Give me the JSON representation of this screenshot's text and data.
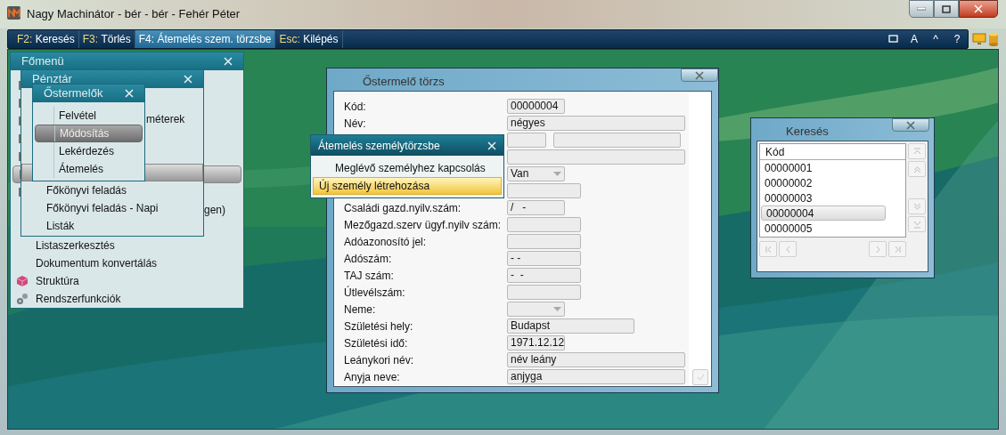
{
  "window": {
    "title": "Nagy Machinátor - bér - bér - Fehér Péter"
  },
  "toolbar": {
    "commands": [
      {
        "key": "F2:",
        "label": "Keresés",
        "selected": false
      },
      {
        "key": "F3:",
        "label": "Törlés",
        "selected": false
      },
      {
        "key": "F4:",
        "label": "Átemelés szem. törzsbe",
        "selected": true
      },
      {
        "key": "Esc:",
        "label": "Kilépés",
        "selected": false
      }
    ],
    "buttons": [
      "A",
      "^",
      "?"
    ]
  },
  "main_menu": {
    "title": "Főmenü",
    "items": [
      {
        "kind": "app",
        "selected": false
      },
      {
        "kind": "app",
        "selected": false
      },
      {
        "kind": "app",
        "selected": false
      },
      {
        "kind": "app",
        "selected": false
      },
      {
        "kind": "app",
        "selected": false
      },
      {
        "kind": "app",
        "selected": true
      },
      {
        "kind": "app",
        "selected": false
      },
      {
        "kind": "none",
        "text": "gen)",
        "selected": false
      },
      {
        "kind": "none",
        "selected": false
      },
      {
        "kind": "none",
        "text": "Listaszerkesztés",
        "selected": false
      },
      {
        "kind": "none",
        "text": "Dokumentum konvertálás",
        "selected": false
      },
      {
        "kind": "cube",
        "text": "Struktúra",
        "selected": false
      },
      {
        "kind": "gears",
        "text": "Rendszerfunkciók",
        "selected": false
      }
    ]
  },
  "cash_menu": {
    "title": "Pénztár",
    "items": [
      {
        "selected": false
      },
      {
        "text": "méterek",
        "selected": false
      },
      {
        "selected": false
      },
      {
        "selected": false
      },
      {
        "selected": true
      },
      {
        "text": "Főkönyvi feladás",
        "selected": false
      },
      {
        "text": "Főkönyvi feladás - Napi",
        "selected": false
      },
      {
        "text": "Listák",
        "selected": false
      }
    ]
  },
  "producer_menu": {
    "title": "Őstermelők",
    "items": [
      {
        "text": "Felvétel",
        "selected": false,
        "disabled": false
      },
      {
        "text": "Módosítás",
        "selected": true,
        "disabled": true
      },
      {
        "text": "Lekérdezés",
        "selected": false,
        "disabled": false
      },
      {
        "text": "Átemelés",
        "selected": false,
        "disabled": false
      }
    ]
  },
  "producer_form": {
    "title": "Őstermelő törzs",
    "fields": [
      {
        "label": "Kód:",
        "kind": "text",
        "value": "00000004"
      },
      {
        "label": "Név:",
        "kind": "text",
        "value": "négyes"
      },
      {
        "kind": "pair"
      },
      {
        "kind": "text"
      },
      {
        "kind": "dropdown",
        "value": "Van"
      },
      {
        "kind": "text"
      },
      {
        "label": "Családi gazd.nyilv.szám:",
        "kind": "text",
        "value": "/   -"
      },
      {
        "label": "Mezőgazd.szerv ügyf.nyilv szám:",
        "kind": "text"
      },
      {
        "label": "Adóazonosító jel:",
        "kind": "text"
      },
      {
        "label": "Adószám:",
        "kind": "text",
        "value": "- -"
      },
      {
        "label": "TAJ szám:",
        "kind": "text",
        "value": "-  -"
      },
      {
        "label": "Útlevélszám:",
        "kind": "text"
      },
      {
        "label": "Neme:",
        "kind": "dropdown"
      },
      {
        "label": "Születési hely:",
        "kind": "text",
        "value": "Budapst"
      },
      {
        "label": "Születési idő:",
        "kind": "text",
        "value": "1971.12.12"
      },
      {
        "label": "Leánykori név:",
        "kind": "text",
        "value": "név leány"
      },
      {
        "label": "Anyja neve:",
        "kind": "text",
        "value": "anjyga"
      }
    ],
    "ok_disabled": true
  },
  "transfer_popup": {
    "title": "Átemelés személytörzsbe",
    "items": [
      {
        "text": "Meglévő személyhez kapcsolás",
        "selected": false
      },
      {
        "text": "Új személy létrehozása",
        "selected": true
      }
    ]
  },
  "search": {
    "title": "Keresés",
    "column": "Kód",
    "rows": [
      {
        "text": "00000001",
        "selected": false
      },
      {
        "text": "00000002",
        "selected": false
      },
      {
        "text": "00000003",
        "selected": false
      },
      {
        "text": "00000004",
        "selected": true
      },
      {
        "text": "00000005",
        "selected": false
      }
    ]
  }
}
